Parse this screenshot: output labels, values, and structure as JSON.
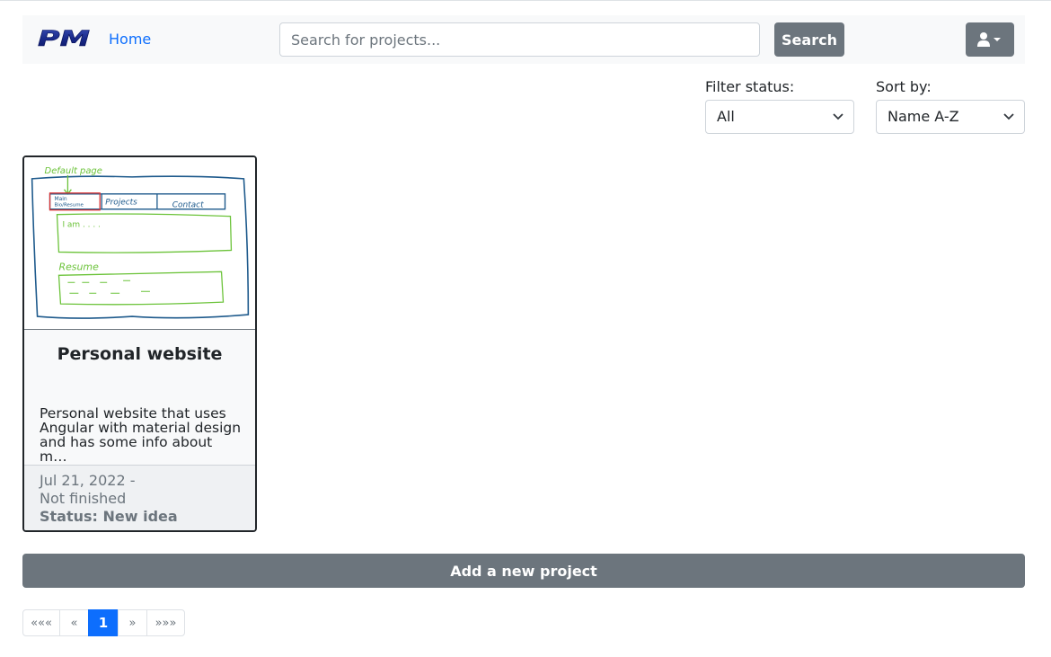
{
  "navbar": {
    "logo_text": "PM",
    "home_label": "Home",
    "search_placeholder": "Search for projects...",
    "search_button": "Search"
  },
  "filters": {
    "status_label": "Filter status:",
    "status_value": "All",
    "sort_label": "Sort by:",
    "sort_value": "Name A-Z"
  },
  "projects": [
    {
      "title": "Personal website",
      "description_lines": [
        "Personal website that uses",
        "Angular with material design",
        "and has some info about m…"
      ],
      "date_line": "Jul 21, 2022 -",
      "end_line": "Not finished",
      "status": "Status: New idea",
      "sketch_labels": {
        "default_page": "Default page",
        "tab_main": "Main",
        "tab_main_sub": "Bio/Resume",
        "tab_projects": "Projects",
        "tab_contact": "Contact",
        "intro": "I am . . . .",
        "resume": "Resume"
      }
    }
  ],
  "add_button": "Add a new project",
  "pagination": {
    "first": "«««",
    "prev": "«",
    "current": "1",
    "next": "»",
    "last": "»»»"
  },
  "colors": {
    "accent": "#0d6efd",
    "secondary": "#6c757d",
    "logo_blue": "#1a2a8a"
  }
}
